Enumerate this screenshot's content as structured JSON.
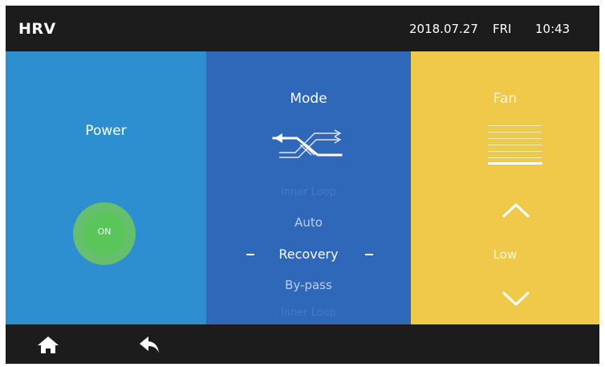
{
  "header": {
    "app_title": "HRV",
    "date": "2018.07.27",
    "day": "FRI",
    "time": "10:43"
  },
  "power": {
    "title": "Power",
    "button_label": "ON",
    "button_color": "#59c55a"
  },
  "mode": {
    "title": "Mode",
    "icon": "heat-recovery-icon",
    "options_visible": [
      "Inner Loop",
      "Auto",
      "Recovery",
      "By-pass",
      "Inner Loop"
    ],
    "selected": "Recovery",
    "selected_index": 2
  },
  "fan": {
    "title": "Fan",
    "speed": "Low",
    "level_bars_total": 6,
    "level_bars_active": 1,
    "up_icon": "chevron-up-icon",
    "down_icon": "chevron-down-icon"
  },
  "footer": {
    "home_icon": "home-icon",
    "back_icon": "back-arrow-icon"
  },
  "colors": {
    "power_panel": "#2e8fd0",
    "mode_panel": "#2f67b9",
    "fan_panel": "#f0c84a",
    "bar": "#1c1c1c"
  }
}
